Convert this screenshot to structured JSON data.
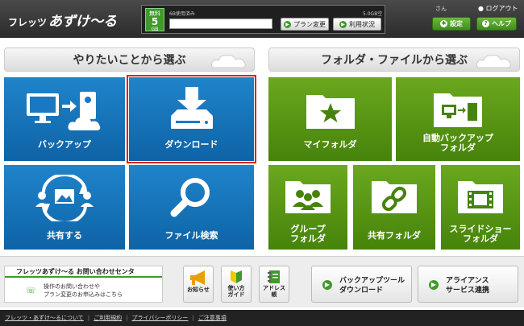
{
  "header": {
    "logo_part1": "フレッツ",
    "logo_part2": "あずけ〜る",
    "plan": {
      "label": "無料",
      "size": "5",
      "unit": "GB"
    },
    "usage": {
      "used_text": "6B使用済み",
      "free_text": "5.0GB空き",
      "fraction_used": 0.0
    },
    "plan_change_label": "プラン変更",
    "usage_status_label": "利用状況",
    "user_suffix": "さん",
    "logout_label": "ログアウト",
    "settings_label": "設定",
    "help_label": "ヘルプ"
  },
  "sections": {
    "left_title": "やりたいことから選ぶ",
    "right_title": "フォルダ・ファイルから選ぶ"
  },
  "tiles": {
    "backup": "バックアップ",
    "download": "ダウンロード",
    "share": "共有する",
    "file_search": "ファイル検索",
    "my_folder": "マイフォルダ",
    "auto_backup_1": "自動バックアップ",
    "auto_backup_2": "フォルダ",
    "group_folder_1": "グループ",
    "group_folder_2": "フォルダ",
    "shared_folder": "共有フォルダ",
    "slideshow_1": "スライドショー",
    "slideshow_2": "フォルダ"
  },
  "bottom": {
    "contact_title": "フレッツあずけ〜る お問い合わせセンタ",
    "contact_line1": "操作のお問い合わせや",
    "contact_line2": "プラン変更のお申込みはこちら",
    "notice_label": "お知らせ",
    "guide_1": "使い方",
    "guide_2": "ガイド",
    "address_1": "アドレス",
    "address_2": "帳",
    "backup_tool_1": "バックアップツール",
    "backup_tool_2": "ダウンロード",
    "alliance_1": "アライアンス",
    "alliance_2": "サービス連携"
  },
  "footer": {
    "about": "フレッツ・あずけ〜るについて",
    "terms": "ご利用規約",
    "privacy": "プライバシーポリシー",
    "notes": "ご注意事項"
  },
  "colors": {
    "blue": "#1a78c2",
    "green": "#5b9a14",
    "accent": "#3f9a2a",
    "highlight": "#e02020"
  }
}
